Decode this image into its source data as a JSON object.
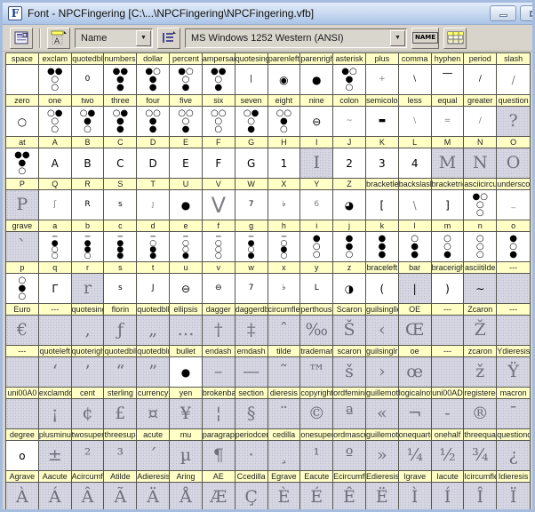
{
  "window": {
    "title": "Font - NPCFingering [C:\\...\\NPCFingering\\NPCFingering.vfb]",
    "app_icon_letter": "F",
    "controls": [
      "minimize",
      "maximize"
    ]
  },
  "toolbar": {
    "font_info_button": {
      "icon": "font-window-icon"
    },
    "label_mode_button": {
      "icon": "caption-mode-icon"
    },
    "label_mode_select": {
      "value": "Name",
      "arrow": "▼"
    },
    "encoding_mode_button": {
      "icon": "encoding-list-icon"
    },
    "encoding_select": {
      "value": "MS Windows 1252 Western (ANSI)",
      "arrow": "▼"
    },
    "caption_style_button": {
      "label": "NAME"
    },
    "table_view_button": {
      "icon": "table-grid-icon"
    }
  },
  "colors": {
    "caption_bg": "#ffffc6",
    "empty_cell_bg": "#d6d6e3",
    "template_glyph": "#6f6f7c",
    "titlebar": "#c3d5ee",
    "toolbar_bg": "#d8d4cb"
  },
  "grid": {
    "columns": 16,
    "rows": [
      [
        {
          "n": "space",
          "g": "",
          "c": ""
        },
        {
          "n": "exclam",
          "g": "●●\n○\n○",
          "c": "d"
        },
        {
          "n": "quotedbl",
          "g": "0",
          "c": "y"
        },
        {
          "n": "numbersign",
          "g": "●●\n●\n●",
          "c": "d"
        },
        {
          "n": "dollar",
          "g": "●○\n●\n●",
          "c": "d"
        },
        {
          "n": "percent",
          "g": "●○\n○\n●",
          "c": "d"
        },
        {
          "n": "ampersand",
          "g": "●●\n○\n●",
          "c": "d"
        },
        {
          "n": "quotesingle",
          "g": "|",
          "c": "y"
        },
        {
          "n": "parenleft",
          "g": "◉",
          "c": "s"
        },
        {
          "n": "parenright",
          "g": "●",
          "c": "s"
        },
        {
          "n": "asterisk",
          "g": "●○\n●\n○",
          "c": "d"
        },
        {
          "n": "plus",
          "g": "+",
          "c": "y r"
        },
        {
          "n": "comma",
          "g": "\\",
          "c": "y"
        },
        {
          "n": "hyphen",
          "g": "—",
          "c": "s hy"
        },
        {
          "n": "period",
          "g": "/",
          "c": "y"
        },
        {
          "n": "slash",
          "g": "/",
          "c": "s r"
        }
      ],
      [
        {
          "n": "zero",
          "g": "○",
          "c": "s"
        },
        {
          "n": "one",
          "g": "○●\n○\n○",
          "c": "d"
        },
        {
          "n": "two",
          "g": "○●\n●\n○",
          "c": "d"
        },
        {
          "n": "three",
          "g": "○●\n●\n●",
          "c": "d"
        },
        {
          "n": "four",
          "g": "○○\n●\n●",
          "c": "d"
        },
        {
          "n": "five",
          "g": "○○\n○\n●",
          "c": "d"
        },
        {
          "n": "six",
          "g": "○○\n○\n○",
          "c": "d"
        },
        {
          "n": "seven",
          "g": "○●\n○\n●",
          "c": "d"
        },
        {
          "n": "eight",
          "g": "○○\n●\n○",
          "c": "d"
        },
        {
          "n": "nine",
          "g": "⊖",
          "c": "s"
        },
        {
          "n": "colon",
          "g": "~",
          "c": "y r"
        },
        {
          "n": "semicolon",
          "g": "▬",
          "c": "y"
        },
        {
          "n": "less",
          "g": "\\",
          "c": "y r"
        },
        {
          "n": "equal",
          "g": "=",
          "c": "y r"
        },
        {
          "n": "greater",
          "g": "/",
          "c": "y r"
        },
        {
          "n": "question",
          "g": "?",
          "c": "bgg t"
        }
      ],
      [
        {
          "n": "at",
          "g": "●●\n●\n○",
          "c": "d"
        },
        {
          "n": "A",
          "g": "A",
          "c": "s"
        },
        {
          "n": "B",
          "g": "B",
          "c": "s"
        },
        {
          "n": "C",
          "g": "C",
          "c": "s"
        },
        {
          "n": "D",
          "g": "D",
          "c": "s"
        },
        {
          "n": "E",
          "g": "E",
          "c": "s"
        },
        {
          "n": "F",
          "g": "F",
          "c": "s"
        },
        {
          "n": "G",
          "g": "G",
          "c": "s"
        },
        {
          "n": "H",
          "g": "1",
          "c": "s"
        },
        {
          "n": "I",
          "g": "I",
          "c": "bgg t"
        },
        {
          "n": "J",
          "g": "2",
          "c": "s"
        },
        {
          "n": "K",
          "g": "3",
          "c": "s"
        },
        {
          "n": "L",
          "g": "4",
          "c": "s"
        },
        {
          "n": "M",
          "g": "M",
          "c": "bgg t"
        },
        {
          "n": "N",
          "g": "N",
          "c": "bgg t"
        },
        {
          "n": "O",
          "g": "O",
          "c": "bgg t"
        }
      ],
      [
        {
          "n": "P",
          "g": "P",
          "c": "bgg t"
        },
        {
          "n": "Q",
          "g": "ʃ",
          "c": "y r"
        },
        {
          "n": "R",
          "g": "R",
          "c": "y"
        },
        {
          "n": "S",
          "g": "s",
          "c": "y"
        },
        {
          "n": "T",
          "g": "ȷ",
          "c": "y r"
        },
        {
          "n": "U",
          "g": "●",
          "c": "s"
        },
        {
          "n": "V",
          "g": "V",
          "c": "b r"
        },
        {
          "n": "W",
          "g": "7",
          "c": "y"
        },
        {
          "n": "X",
          "g": "♭",
          "c": "y"
        },
        {
          "n": "Y",
          "g": "6",
          "c": "y r"
        },
        {
          "n": "Z",
          "g": "◕",
          "c": "s"
        },
        {
          "n": "bracketleft",
          "g": "[",
          "c": "s"
        },
        {
          "n": "backslash",
          "g": "\\",
          "c": "s r"
        },
        {
          "n": "bracketright",
          "g": "]",
          "c": "s"
        },
        {
          "n": "asciicircum",
          "g": "●○\n○\n○",
          "c": "d"
        },
        {
          "n": "underscore",
          "g": "_",
          "c": "y r"
        }
      ],
      [
        {
          "n": "grave",
          "g": "`",
          "c": "bgg t"
        },
        {
          "n": "a",
          "g": "─\n●\n○\n○",
          "c": "d4"
        },
        {
          "n": "b",
          "g": "─\n●\n●\n○",
          "c": "d4"
        },
        {
          "n": "c",
          "g": "─\n●\n●\n●",
          "c": "d4"
        },
        {
          "n": "d",
          "g": "─\n○\n●\n●",
          "c": "d4"
        },
        {
          "n": "e",
          "g": "─\n○\n○\n●",
          "c": "d4"
        },
        {
          "n": "f",
          "g": "─\n○\n○\n○",
          "c": "d4"
        },
        {
          "n": "g",
          "g": "─\n●\n○\n●",
          "c": "d4"
        },
        {
          "n": "h",
          "g": "─\n○\n●\n○",
          "c": "d4"
        },
        {
          "n": "i",
          "g": "●\n○\n○",
          "c": "d"
        },
        {
          "n": "j",
          "g": "●\n●\n○",
          "c": "d"
        },
        {
          "n": "k",
          "g": "●\n●\n●",
          "c": "d"
        },
        {
          "n": "l",
          "g": "○\n●\n●",
          "c": "d"
        },
        {
          "n": "m",
          "g": "○\n○\n●",
          "c": "d"
        },
        {
          "n": "n",
          "g": "○\n○\n○",
          "c": "d"
        },
        {
          "n": "o",
          "g": "●\n○\n●",
          "c": "d"
        }
      ],
      [
        {
          "n": "p",
          "g": "○\n●\n○",
          "c": "d"
        },
        {
          "n": "q",
          "g": "Γ",
          "c": "s"
        },
        {
          "n": "r",
          "g": "r",
          "c": "bgg t"
        },
        {
          "n": "s",
          "g": "s",
          "c": "y"
        },
        {
          "n": "t",
          "g": "J",
          "c": "y"
        },
        {
          "n": "u",
          "g": "⊖",
          "c": "s"
        },
        {
          "n": "v",
          "g": "⊖",
          "c": "y"
        },
        {
          "n": "w",
          "g": "7",
          "c": "y"
        },
        {
          "n": "x",
          "g": "♭",
          "c": "y"
        },
        {
          "n": "y",
          "g": "L",
          "c": "y"
        },
        {
          "n": "z",
          "g": "◑",
          "c": "s"
        },
        {
          "n": "braceleft",
          "g": "(",
          "c": "s"
        },
        {
          "n": "bar",
          "g": "|",
          "c": "bgg s"
        },
        {
          "n": "braceright",
          "g": ")",
          "c": "s"
        },
        {
          "n": "asciitilde",
          "g": "∼",
          "c": "bgg s"
        },
        {
          "n": "---",
          "g": "",
          "c": "bgg"
        }
      ],
      [
        {
          "n": "Euro",
          "g": "€",
          "c": "bgg t"
        },
        {
          "n": "---",
          "g": "",
          "c": "bgg"
        },
        {
          "n": "quotesinglbase",
          "g": "‚",
          "c": "bgg t"
        },
        {
          "n": "florin",
          "g": "ƒ",
          "c": "bgg t"
        },
        {
          "n": "quotedblbase",
          "g": "„",
          "c": "bgg t"
        },
        {
          "n": "ellipsis",
          "g": "…",
          "c": "bgg t"
        },
        {
          "n": "dagger",
          "g": "†",
          "c": "bgg t"
        },
        {
          "n": "daggerdbl",
          "g": "‡",
          "c": "bgg t"
        },
        {
          "n": "circumflex",
          "g": "ˆ",
          "c": "bgg t"
        },
        {
          "n": "perthousand",
          "g": "‰",
          "c": "bgg t"
        },
        {
          "n": "Scaron",
          "g": "Š",
          "c": "bgg t"
        },
        {
          "n": "guilsinglleft",
          "g": "‹",
          "c": "bgg t"
        },
        {
          "n": "OE",
          "g": "Œ",
          "c": "bgg t"
        },
        {
          "n": "---",
          "g": "",
          "c": "bgg"
        },
        {
          "n": "Zcaron",
          "g": "Ž",
          "c": "bgg t"
        },
        {
          "n": "---",
          "g": "",
          "c": "bgg"
        }
      ],
      [
        {
          "n": "---",
          "g": "",
          "c": "bgg"
        },
        {
          "n": "quoteleft",
          "g": "‘",
          "c": "bgg t"
        },
        {
          "n": "quoteright",
          "g": "’",
          "c": "bgg t"
        },
        {
          "n": "quotedblleft",
          "g": "“",
          "c": "bgg t"
        },
        {
          "n": "quotedblright",
          "g": "”",
          "c": "bgg t"
        },
        {
          "n": "bullet",
          "g": "●",
          "c": "s"
        },
        {
          "n": "endash",
          "g": "–",
          "c": "bgg t"
        },
        {
          "n": "emdash",
          "g": "—",
          "c": "bgg t"
        },
        {
          "n": "tilde",
          "g": "˜",
          "c": "bgg t"
        },
        {
          "n": "trademark",
          "g": "™",
          "c": "bgg t"
        },
        {
          "n": "scaron",
          "g": "š",
          "c": "bgg t"
        },
        {
          "n": "guilsinglright",
          "g": "›",
          "c": "bgg t"
        },
        {
          "n": "oe",
          "g": "œ",
          "c": "bgg t"
        },
        {
          "n": "---",
          "g": "",
          "c": "bgg"
        },
        {
          "n": "zcaron",
          "g": "ž",
          "c": "bgg t"
        },
        {
          "n": "Ydieresis",
          "g": "Ÿ",
          "c": "bgg t"
        }
      ],
      [
        {
          "n": "uni00A0",
          "g": "",
          "c": "bgg"
        },
        {
          "n": "exclamdown",
          "g": "¡",
          "c": "bgg t"
        },
        {
          "n": "cent",
          "g": "¢",
          "c": "bgg t"
        },
        {
          "n": "sterling",
          "g": "£",
          "c": "bgg t"
        },
        {
          "n": "currency",
          "g": "¤",
          "c": "bgg t"
        },
        {
          "n": "yen",
          "g": "¥",
          "c": "bgg t"
        },
        {
          "n": "brokenbar",
          "g": "¦",
          "c": "bgg t"
        },
        {
          "n": "section",
          "g": "§",
          "c": "bgg t"
        },
        {
          "n": "dieresis",
          "g": "¨",
          "c": "bgg t"
        },
        {
          "n": "copyright",
          "g": "©",
          "c": "bgg t"
        },
        {
          "n": "ordfeminine",
          "g": "ª",
          "c": "bgg t"
        },
        {
          "n": "guillemotleft",
          "g": "«",
          "c": "bgg t"
        },
        {
          "n": "logicalnot",
          "g": "¬",
          "c": "bgg t"
        },
        {
          "n": "uni00AD",
          "g": "-",
          "c": "bgg t"
        },
        {
          "n": "registered",
          "g": "®",
          "c": "bgg t"
        },
        {
          "n": "macron",
          "g": "¯",
          "c": "bgg t"
        }
      ],
      [
        {
          "n": "degree",
          "g": "o",
          "c": "s"
        },
        {
          "n": "plusminus",
          "g": "±",
          "c": "bgg t"
        },
        {
          "n": "twosuperior",
          "g": "²",
          "c": "bgg t"
        },
        {
          "n": "threesuperior",
          "g": "³",
          "c": "bgg t"
        },
        {
          "n": "acute",
          "g": "´",
          "c": "bgg t"
        },
        {
          "n": "mu",
          "g": "µ",
          "c": "bgg t"
        },
        {
          "n": "paragraph",
          "g": "¶",
          "c": "bgg t"
        },
        {
          "n": "periodcentered",
          "g": "·",
          "c": "bgg t"
        },
        {
          "n": "cedilla",
          "g": "¸",
          "c": "bgg t"
        },
        {
          "n": "onesuperior",
          "g": "¹",
          "c": "bgg t"
        },
        {
          "n": "ordmasculine",
          "g": "º",
          "c": "bgg t"
        },
        {
          "n": "guillemotright",
          "g": "»",
          "c": "bgg t"
        },
        {
          "n": "onequarter",
          "g": "¼",
          "c": "bgg t"
        },
        {
          "n": "onehalf",
          "g": "½",
          "c": "bgg t"
        },
        {
          "n": "threequarters",
          "g": "¾",
          "c": "bgg t"
        },
        {
          "n": "questiondown",
          "g": "¿",
          "c": "bgg t"
        }
      ],
      [
        {
          "n": "Agrave",
          "g": "À",
          "c": "bgg t"
        },
        {
          "n": "Aacute",
          "g": "Á",
          "c": "bgg t"
        },
        {
          "n": "Acircumflex",
          "g": "Â",
          "c": "bgg t"
        },
        {
          "n": "Atilde",
          "g": "Ã",
          "c": "bgg t"
        },
        {
          "n": "Adieresis",
          "g": "Ä",
          "c": "bgg t"
        },
        {
          "n": "Aring",
          "g": "Å",
          "c": "bgg t"
        },
        {
          "n": "AE",
          "g": "Æ",
          "c": "bgg t"
        },
        {
          "n": "Ccedilla",
          "g": "Ç",
          "c": "bgg t"
        },
        {
          "n": "Egrave",
          "g": "È",
          "c": "bgg t"
        },
        {
          "n": "Eacute",
          "g": "É",
          "c": "bgg t"
        },
        {
          "n": "Ecircumflex",
          "g": "Ê",
          "c": "bgg t"
        },
        {
          "n": "Edieresis",
          "g": "Ë",
          "c": "bgg t"
        },
        {
          "n": "Igrave",
          "g": "Ì",
          "c": "bgg t"
        },
        {
          "n": "Iacute",
          "g": "Í",
          "c": "bgg t"
        },
        {
          "n": "Icircumflex",
          "g": "Î",
          "c": "bgg t"
        },
        {
          "n": "Idieresis",
          "g": "Ï",
          "c": "bgg t"
        }
      ]
    ]
  }
}
